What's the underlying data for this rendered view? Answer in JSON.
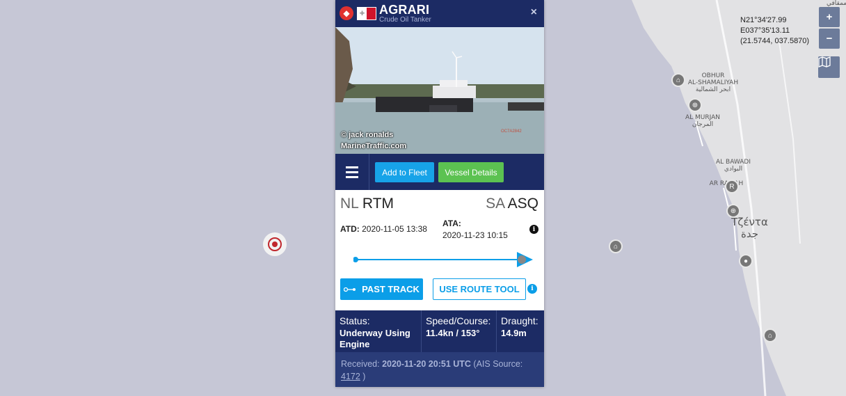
{
  "map": {
    "cursor_coords": {
      "lat_dms": "N21°34'27.99",
      "lon_dms": "E037°35'13.11",
      "decimal": "(21.5744, 037.5870)"
    },
    "zoom_in": "+",
    "zoom_out": "−",
    "layers_icon": "map-layers-icon",
    "places": [
      {
        "en": "OBHUR",
        "en2": "AL-SHAMALIYAH",
        "ar": "ابحر الشمالية"
      },
      {
        "en": "AL MURJAN",
        "ar": "المرجان"
      },
      {
        "en": "AL BAWADI",
        "ar": "البوادي"
      },
      {
        "en": "AR RA...AH",
        "ar": ""
      },
      {
        "en": "Τζέντα",
        "ar": "جدة"
      }
    ],
    "top_corner_text": "ممقافي"
  },
  "vessel": {
    "name": "AGRARI",
    "type": "Crude Oil Tanker",
    "photo_credit": "© jack ronalds",
    "photo_source": "MarineTraffic.com",
    "photo_code": "OC7A2842",
    "close": "×",
    "colors": {
      "header": "#1c2b64",
      "fleet": "#17a3e8",
      "details": "#5cc251",
      "marker": "#c0272d"
    }
  },
  "actions": {
    "add_to_fleet": "Add to Fleet",
    "vessel_details": "Vessel Details"
  },
  "voyage": {
    "from_country": "NL",
    "from_port": "RTM",
    "to_country": "SA",
    "to_port": "ASQ",
    "atd_label": "ATD:",
    "atd_value": "2020-11-05 13:38",
    "ata_label": "ATA:",
    "ata_value": "2020-11-23 10:15",
    "progress": 0.96,
    "past_track": "PAST TRACK",
    "use_route_tool": "USE ROUTE TOOL"
  },
  "stats": {
    "status_label": "Status:",
    "status_value": "Underway Using Engine",
    "speed_label": "Speed/Course:",
    "speed_value": "11.4kn / 153°",
    "draught_label": "Draught:",
    "draught_value": "14.9m"
  },
  "received": {
    "label": "Received:",
    "value": "2020-11-20 20:51 UTC",
    "ais_prefix": "(AIS Source:",
    "ais_source": "4172",
    "ais_suffix": ")"
  }
}
